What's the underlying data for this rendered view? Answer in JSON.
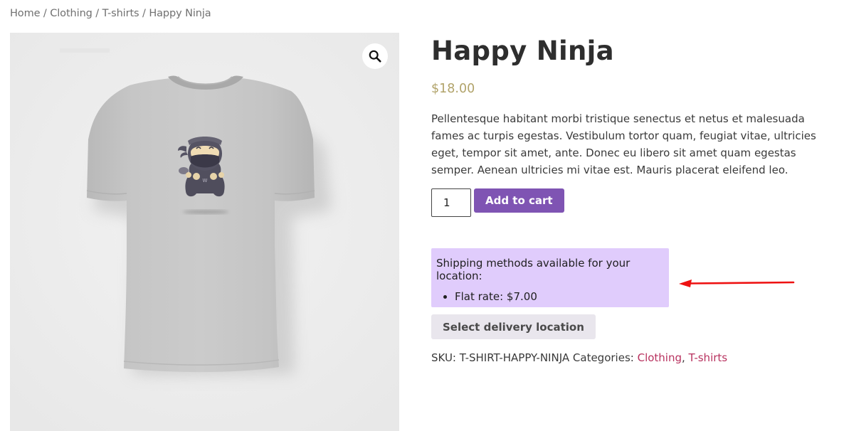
{
  "breadcrumb": {
    "items": [
      "Home",
      "Clothing",
      "T-shirts",
      "Happy Ninja"
    ],
    "separator": " / "
  },
  "gallery": {
    "zoom_icon": "magnifier-icon",
    "image_alt": "Gray t-shirt with smiling ninja mascot"
  },
  "product": {
    "title": "Happy Ninja",
    "price": "$18.00",
    "description": "Pellentesque habitant morbi tristique senectus et netus et malesuada fames ac turpis egestas. Vestibulum tortor quam, feugiat vitae, ultricies eget, tempor sit amet, ante. Donec eu libero sit amet quam egestas semper. Aenean ultricies mi vitae est. Mauris placerat eleifend leo.",
    "quantity": "1",
    "add_to_cart_label": "Add to cart"
  },
  "shipping": {
    "heading": "Shipping methods available for your location:",
    "methods": [
      "Flat rate: $7.00"
    ],
    "select_location_label": "Select delivery location"
  },
  "meta": {
    "sku_label": "SKU:",
    "sku_value": "T-SHIRT-HAPPY-NINJA",
    "categories_label": "Categories:",
    "categories": [
      "Clothing",
      "T-shirts"
    ],
    "category_separator": ", "
  },
  "annotation": {
    "arrow_color": "#ee1111"
  },
  "colors": {
    "accent_purple": "#7f54b3",
    "price_gold": "#b1a36a",
    "shipping_bg": "#e0ccfc",
    "link": "#b8325f"
  }
}
